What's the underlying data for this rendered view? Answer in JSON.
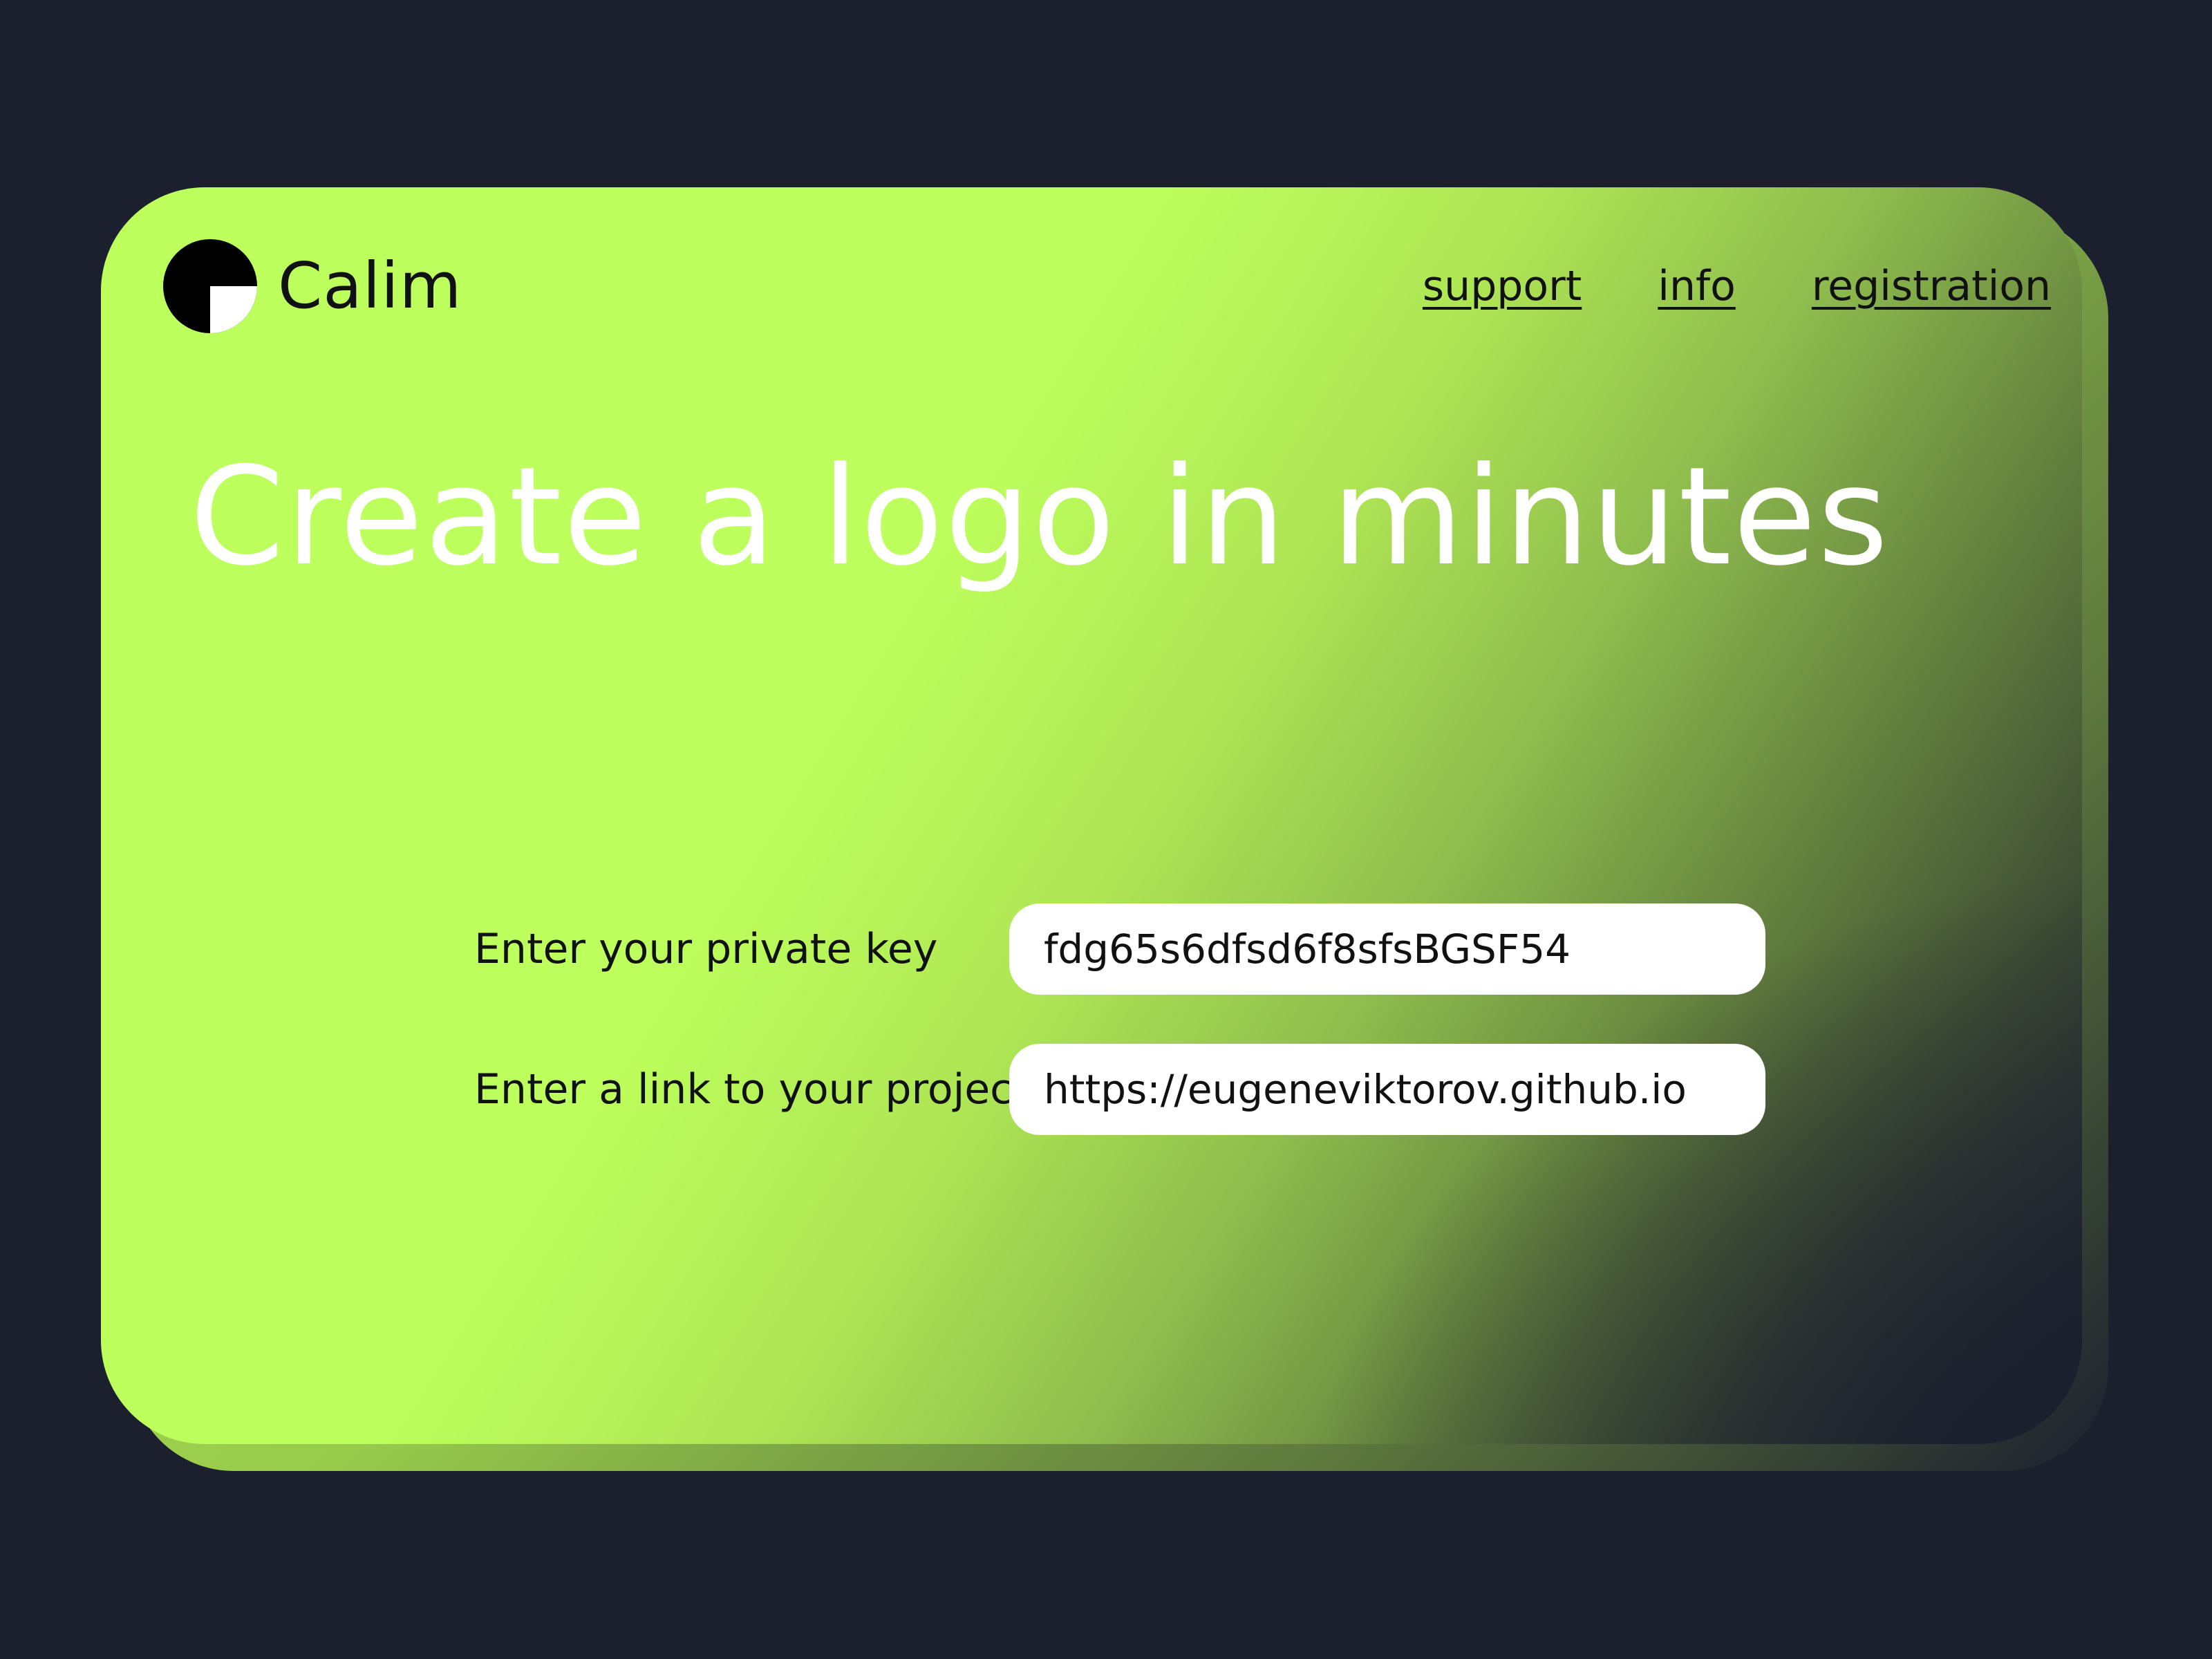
{
  "brand": {
    "name": "Calim",
    "logo_icon": "calim-logo-icon"
  },
  "nav": {
    "support": "support",
    "info": "info",
    "registration": "registration"
  },
  "hero": {
    "headline": "Create a logo in minutes"
  },
  "form": {
    "private_key": {
      "label": "Enter your private key",
      "value": "fdg65s6dfsd6f8sfsBGSF54"
    },
    "project_link": {
      "label": "Enter a link to your project",
      "value": "https://eugeneviktorov.github.io"
    }
  },
  "colors": {
    "background": "#1c1f2e",
    "accent": "#bdff5c",
    "text": "#111111",
    "headline": "#ffffff"
  }
}
